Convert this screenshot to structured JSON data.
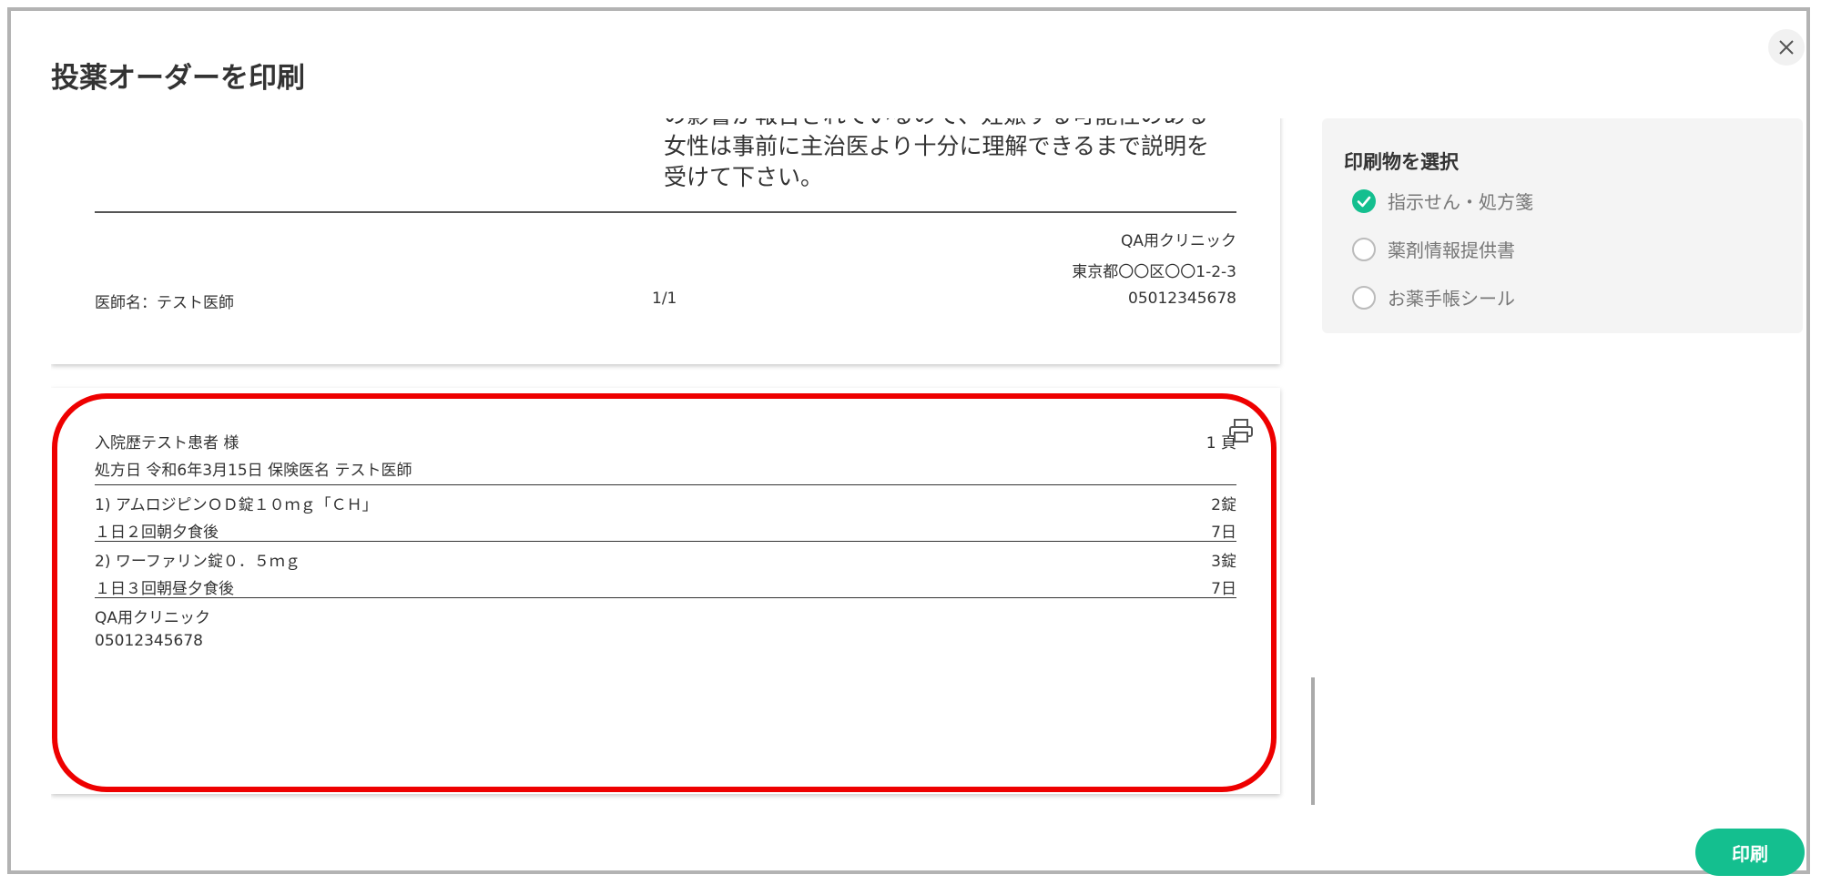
{
  "dialog": {
    "title": "投薬オーダーを印刷",
    "print_button": "印刷"
  },
  "page1": {
    "warning_lines": [
      "の影響が報告されているので、妊娠する可能性のある",
      "女性は事前に主治医より十分に理解できるまで説明を",
      "受けて下さい。"
    ],
    "clinic_name": "QA用クリニック",
    "clinic_address": "東京都〇〇区〇〇1-2-3",
    "clinic_phone": "05012345678",
    "doctor_label": "医師名：テスト医師",
    "page_number": "1/1"
  },
  "page2": {
    "patient": "入院歴テスト患者 様",
    "page_count": "1 頁",
    "prescription_info": "処方日 令和6年3月15日 保険医名 テスト医師",
    "items": [
      {
        "name": "1) アムロジピンＯＤ錠１０ｍｇ「ＣＨ」",
        "qty": "2錠",
        "usage": "１日２回朝夕食後",
        "days": "7日"
      },
      {
        "name": "2) ワーファリン錠０．５ｍｇ",
        "qty": "3錠",
        "usage": "１日３回朝昼夕食後",
        "days": "7日"
      }
    ],
    "clinic_name": "QA用クリニック",
    "clinic_phone": "05012345678"
  },
  "side": {
    "title": "印刷物を選択",
    "options": [
      {
        "label": "指示せん・処方箋",
        "selected": true
      },
      {
        "label": "薬剤情報提供書",
        "selected": false
      },
      {
        "label": "お薬手帳シール",
        "selected": false
      }
    ]
  },
  "colors": {
    "accent": "#14bf8f",
    "highlight": "#ee0000"
  }
}
